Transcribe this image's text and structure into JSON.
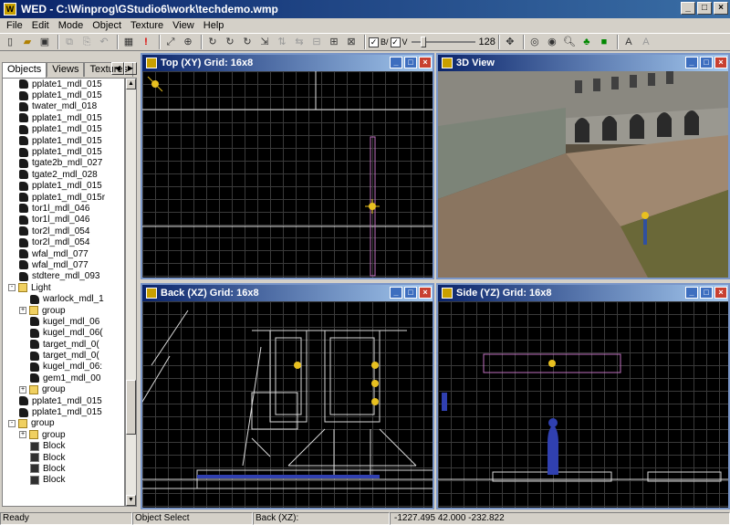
{
  "window": {
    "title": "WED - C:\\Winprog\\GStudio6\\work\\techdemo.wmp"
  },
  "menu": [
    "File",
    "Edit",
    "Mode",
    "Object",
    "Texture",
    "View",
    "Help"
  ],
  "toolbar": {
    "slider_value": "128"
  },
  "sidebar": {
    "tabs": [
      "Objects",
      "Views",
      "Textures"
    ],
    "tree": [
      {
        "label": "pplate1_mdl_015",
        "icon": "model-icon",
        "indent": 3
      },
      {
        "label": "pplate1_mdl_015",
        "icon": "model-icon",
        "indent": 3
      },
      {
        "label": "twater_mdl_018",
        "icon": "model-icon",
        "indent": 3
      },
      {
        "label": "pplate1_mdl_015",
        "icon": "model-icon",
        "indent": 3
      },
      {
        "label": "pplate1_mdl_015",
        "icon": "model-icon",
        "indent": 3
      },
      {
        "label": "pplate1_mdl_015",
        "icon": "model-icon",
        "indent": 3
      },
      {
        "label": "pplate1_mdl_015",
        "icon": "model-icon",
        "indent": 3
      },
      {
        "label": "tgate2b_mdl_027",
        "icon": "model-icon",
        "indent": 3
      },
      {
        "label": "tgate2_mdl_028",
        "icon": "model-icon",
        "indent": 3
      },
      {
        "label": "pplate1_mdl_015",
        "icon": "model-icon",
        "indent": 3
      },
      {
        "label": "pplate1_mdl_015r",
        "icon": "model-icon",
        "indent": 3
      },
      {
        "label": "tor1l_mdl_046",
        "icon": "model-icon",
        "indent": 3
      },
      {
        "label": "tor1l_mdl_046",
        "icon": "model-icon",
        "indent": 3
      },
      {
        "label": "tor2l_mdl_054",
        "icon": "model-icon",
        "indent": 3
      },
      {
        "label": "tor2l_mdl_054",
        "icon": "model-icon",
        "indent": 3
      },
      {
        "label": "wfal_mdl_077",
        "icon": "model-icon",
        "indent": 3
      },
      {
        "label": "wfal_mdl_077",
        "icon": "model-icon",
        "indent": 3
      },
      {
        "label": "stdtere_mdl_093",
        "icon": "model-icon",
        "indent": 3
      },
      {
        "label": "Light",
        "icon": "folder-icon",
        "indent": 2,
        "expander": "-"
      },
      {
        "label": "warlock_mdl_1",
        "icon": "model-icon",
        "indent": 4
      },
      {
        "label": "group",
        "icon": "folder-icon",
        "indent": 3,
        "expander": "+"
      },
      {
        "label": "kugel_mdl_06",
        "icon": "model-icon",
        "indent": 4
      },
      {
        "label": "kugel_mdl_06(",
        "icon": "model-icon",
        "indent": 4
      },
      {
        "label": "target_mdl_0(",
        "icon": "model-icon",
        "indent": 4
      },
      {
        "label": "target_mdl_0(",
        "icon": "model-icon",
        "indent": 4
      },
      {
        "label": "kugel_mdl_06:",
        "icon": "model-icon",
        "indent": 4
      },
      {
        "label": "gem1_mdl_00",
        "icon": "model-icon",
        "indent": 4
      },
      {
        "label": "group",
        "icon": "folder-icon",
        "indent": 3,
        "expander": "+"
      },
      {
        "label": "pplate1_mdl_015",
        "icon": "model-icon",
        "indent": 3
      },
      {
        "label": "pplate1_mdl_015",
        "icon": "model-icon",
        "indent": 3
      },
      {
        "label": "group",
        "icon": "folder-icon",
        "indent": 2,
        "expander": "-"
      },
      {
        "label": "group",
        "icon": "folder-icon",
        "indent": 3,
        "expander": "+"
      },
      {
        "label": "Block",
        "icon": "block-icon",
        "indent": 4
      },
      {
        "label": "Block",
        "icon": "block-icon",
        "indent": 4
      },
      {
        "label": "Block",
        "icon": "block-icon",
        "indent": 4
      },
      {
        "label": "Block",
        "icon": "block-icon",
        "indent": 4
      }
    ]
  },
  "viewports": {
    "top": {
      "title": "Top (XY) Grid: 16x8"
    },
    "view3d": {
      "title": "3D View"
    },
    "back": {
      "title": "Back (XZ) Grid: 16x8"
    },
    "side": {
      "title": "Side (YZ) Grid: 16x8"
    }
  },
  "status": {
    "ready": "Ready",
    "mode": "Object Select",
    "view": "Back (XZ):",
    "coords": "-1227.495 42.000 -232.822"
  }
}
